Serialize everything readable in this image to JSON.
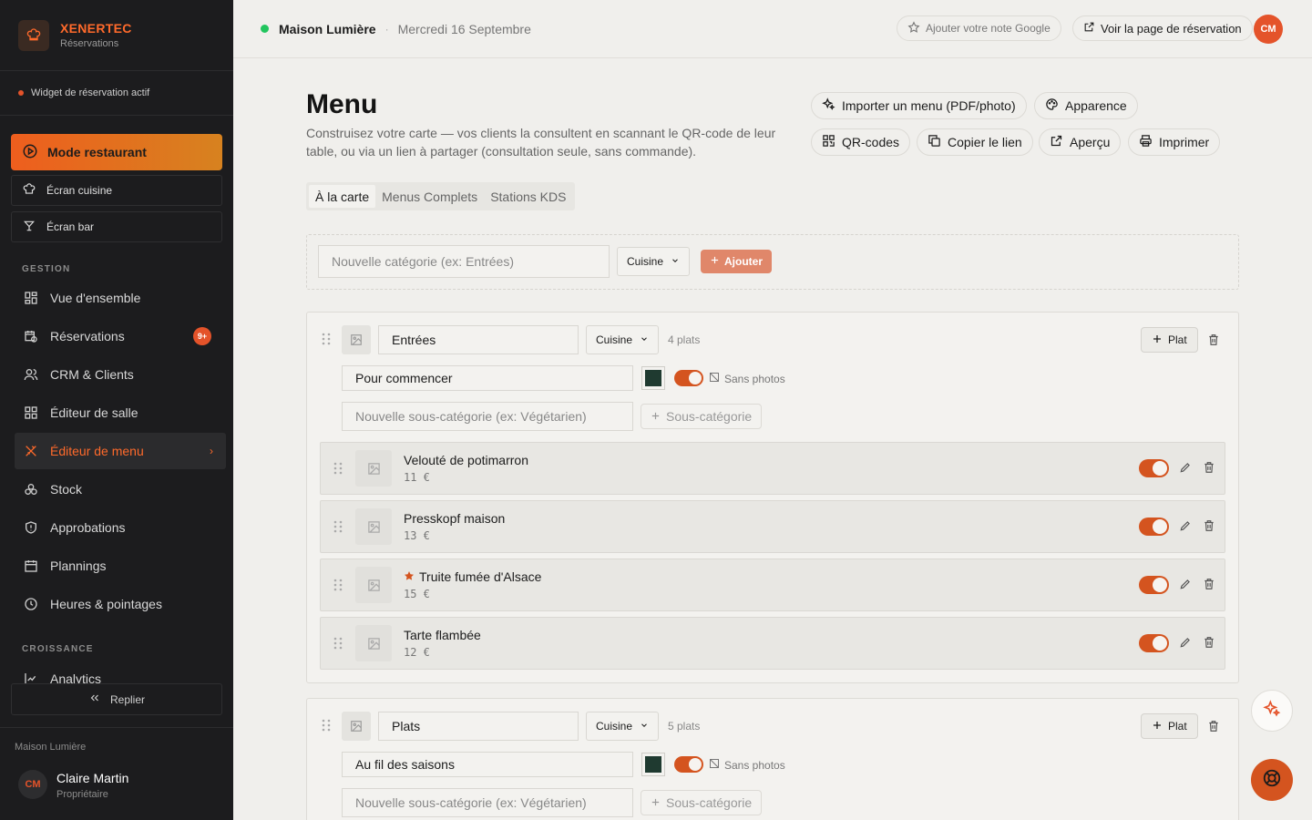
{
  "brand": {
    "name": "XENERTEC",
    "subtitle": "Réservations"
  },
  "widget_status": "Widget de réservation actif",
  "sidebar": {
    "mode_button": "Mode restaurant",
    "kitchen_screen": "Écran cuisine",
    "bar_screen": "Écran bar",
    "section_management": "GESTION",
    "section_growth": "CROISSANCE",
    "items": [
      {
        "label": "Vue d'ensemble",
        "icon": "grid-icon"
      },
      {
        "label": "Réservations",
        "icon": "calendar-clock-icon",
        "badge": "9+"
      },
      {
        "label": "CRM & Clients",
        "icon": "users-icon"
      },
      {
        "label": "Éditeur de salle",
        "icon": "layout-icon"
      },
      {
        "label": "Éditeur de menu",
        "icon": "utensils-icon",
        "active": true
      },
      {
        "label": "Stock",
        "icon": "boxes-icon"
      },
      {
        "label": "Approbations",
        "icon": "shield-icon"
      },
      {
        "label": "Plannings",
        "icon": "calendar-icon"
      },
      {
        "label": "Heures & pointages",
        "icon": "clock-icon"
      }
    ],
    "analytics": "Analytics",
    "collapse": "Replier",
    "footer": {
      "org": "Maison Lumière",
      "initials": "CM",
      "name": "Claire Martin",
      "role": "Propriétaire"
    }
  },
  "topbar": {
    "restaurant": "Maison Lumière",
    "separator": "·",
    "date": "Mercredi 16 Septembre",
    "google_rating": "Ajouter votre note Google",
    "booking_page": "Voir la page de réservation",
    "avatar": "CM"
  },
  "page": {
    "title": "Menu",
    "description": "Construisez votre carte — vos clients la consultent en scannant le QR-code de leur table, ou via un lien à partager (consultation seule, sans commande).",
    "actions": {
      "import": "Importer un menu (PDF/photo)",
      "appearance": "Apparence",
      "qr": "QR-codes",
      "copy_link": "Copier le lien",
      "preview": "Aperçu",
      "print": "Imprimer"
    },
    "tabs": [
      "À la carte",
      "Menus Complets",
      "Stations KDS"
    ]
  },
  "new_category": {
    "placeholder": "Nouvelle catégorie (ex: Entrées)",
    "station": "Cuisine",
    "add": "Ajouter"
  },
  "categories": [
    {
      "name": "Entrées",
      "station": "Cuisine",
      "count": "4 plats",
      "add_dish": "Plat",
      "subtitle": "Pour commencer",
      "no_photos": "Sans photos",
      "subcat_placeholder": "Nouvelle sous-catégorie (ex: Végétarien)",
      "subcat_button": "Sous-catégorie",
      "dishes": [
        {
          "name": "Velouté de potimarron",
          "price": "11 €",
          "featured": false
        },
        {
          "name": "Presskopf maison",
          "price": "13 €",
          "featured": false
        },
        {
          "name": "Truite fumée d'Alsace",
          "price": "15 €",
          "featured": true
        },
        {
          "name": "Tarte flambée",
          "price": "12 €",
          "featured": false
        }
      ]
    },
    {
      "name": "Plats",
      "station": "Cuisine",
      "count": "5 plats",
      "add_dish": "Plat",
      "subtitle": "Au fil des saisons",
      "no_photos": "Sans photos",
      "subcat_placeholder": "Nouvelle sous-catégorie (ex: Végétarien)",
      "subcat_button": "Sous-catégorie"
    }
  ],
  "colors": {
    "accent": "#e4532a",
    "sidebar_bg": "#1c1c1e",
    "page_bg": "#f0efec",
    "swatch": "#1f3a30",
    "online": "#22c55e"
  }
}
